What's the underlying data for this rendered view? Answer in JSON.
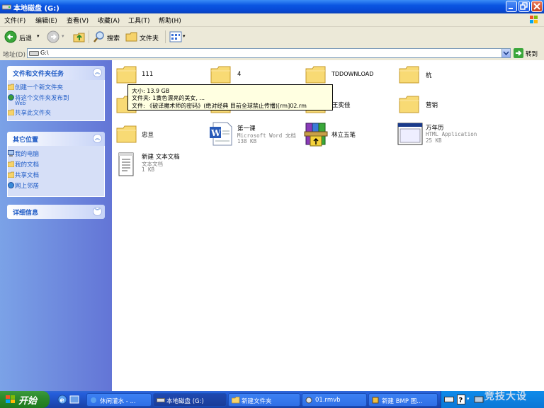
{
  "window": {
    "title": "本地磁盘 (G:)"
  },
  "menu": {
    "items": [
      "文件(F)",
      "编辑(E)",
      "查看(V)",
      "收藏(A)",
      "工具(T)",
      "帮助(H)"
    ]
  },
  "toolbar": {
    "back_label": "后退",
    "search_label": "搜索",
    "folders_label": "文件夹"
  },
  "address": {
    "label": "地址(D)",
    "value": "G:\\",
    "go_label": "转到"
  },
  "tasks_panel": {
    "title": "文件和文件夹任务",
    "items": [
      "创建一个新文件夹",
      "将这个文件夹发布到",
      "Web",
      "共享此文件夹"
    ]
  },
  "places_panel": {
    "title": "其它位置",
    "items": [
      "我的电脑",
      "我的文档",
      "共享文档",
      "网上邻居"
    ]
  },
  "details_panel": {
    "title": "详细信息"
  },
  "files": [
    {
      "name": "111",
      "type": "folder"
    },
    {
      "name": "4",
      "type": "folder"
    },
    {
      "name": "TDDOWNLOAD",
      "type": "folder"
    },
    {
      "name": "杭",
      "type": "folder"
    },
    {
      "name": "王奕佳",
      "type": "folder"
    },
    {
      "name": "营销",
      "type": "folder"
    },
    {
      "name": "忠旦",
      "type": "folder"
    },
    {
      "name": "第一课",
      "type": "word",
      "kind": "Microsoft Word 文档",
      "size": "138 KB"
    },
    {
      "name": "林立五笔",
      "type": "archive"
    },
    {
      "name": "万年历",
      "type": "hta",
      "kind": "HTML Application",
      "size": "25 KB"
    },
    {
      "name": "新建 文本文档",
      "type": "text",
      "kind": "文本文档",
      "size": "1 KB"
    }
  ],
  "tooltip": {
    "line1": "大小: 13.9 GB",
    "line2": "文件夹: 1黄色漂亮的美女, ...",
    "line3": "文件: 《破译魔术师的密码》(绝对经典 目前全球禁止传播)[rm]02.rm"
  },
  "taskbar": {
    "start_label": "开始",
    "tasks": [
      "休闲灌水 - ...",
      "本地磁盘 (G:)",
      "新建文件夹",
      "01.rmvb",
      "新建 BMP 图..."
    ]
  },
  "watermark": "竞技大设",
  "colors": {
    "xp_blue": "#0a55e2",
    "panel_text": "#215dc6",
    "start_green": "#2c8a2c"
  }
}
